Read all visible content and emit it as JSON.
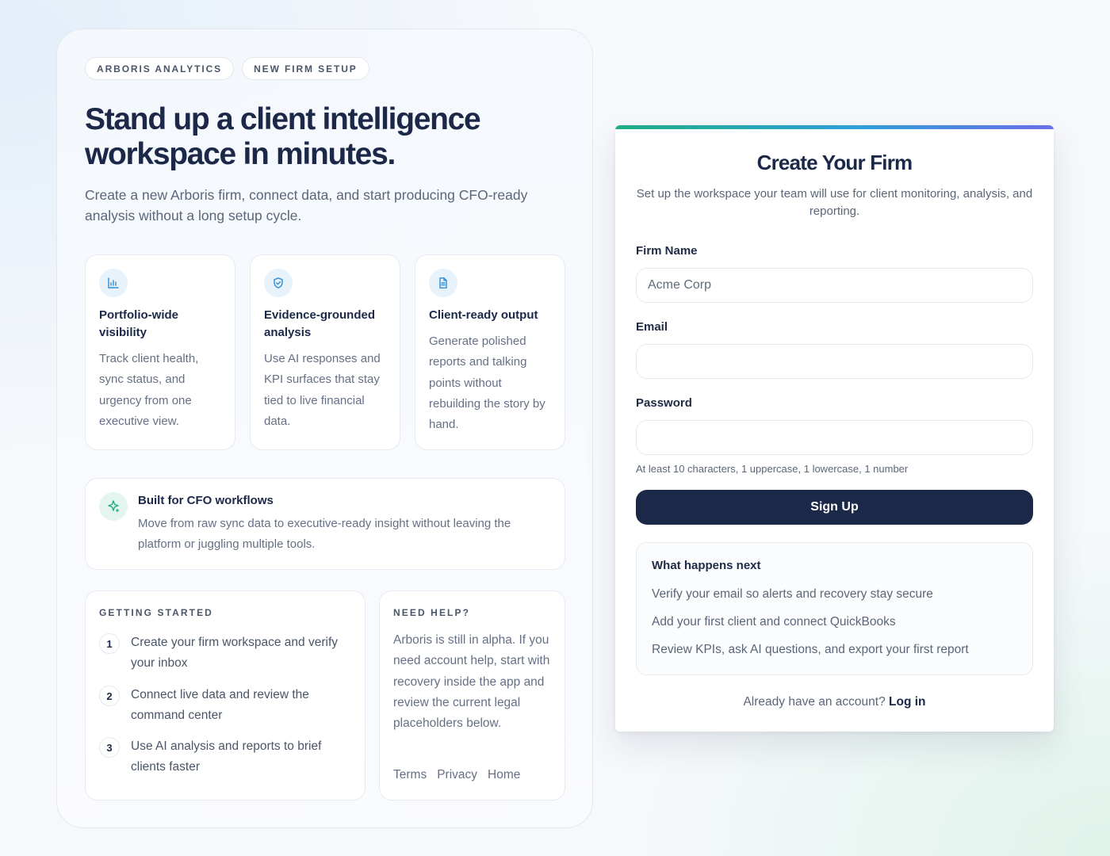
{
  "left": {
    "chips": [
      "ARBORIS ANALYTICS",
      "NEW FIRM SETUP"
    ],
    "title": "Stand up a client intelligence workspace in minutes.",
    "subtitle": "Create a new Arboris firm, connect data, and start producing CFO-ready analysis without a long setup cycle.",
    "features": [
      {
        "icon": "bar-chart-icon",
        "title": "Portfolio-wide visibility",
        "body": "Track client health, sync status, and urgency from one executive view."
      },
      {
        "icon": "shield-check-icon",
        "title": "Evidence-grounded analysis",
        "body": "Use AI responses and KPI surfaces that stay tied to live financial data."
      },
      {
        "icon": "document-icon",
        "title": "Client-ready output",
        "body": "Generate polished reports and talking points without rebuilding the story by hand."
      }
    ],
    "cfo": {
      "icon": "sparkle-icon",
      "title": "Built for CFO workflows",
      "body": "Move from raw sync data to executive-ready insight without leaving the platform or juggling multiple tools."
    },
    "getting_started": {
      "heading": "GETTING STARTED",
      "steps": [
        {
          "num": "1",
          "text": "Create your firm workspace and verify your inbox"
        },
        {
          "num": "2",
          "text": "Connect live data and review the command center"
        },
        {
          "num": "3",
          "text": "Use AI analysis and reports to brief clients faster"
        }
      ]
    },
    "help": {
      "heading": "NEED HELP?",
      "body": "Arboris is still in alpha. If you need account help, start with recovery inside the app and review the current legal placeholders below.",
      "links": [
        "Terms",
        "Privacy",
        "Home"
      ]
    }
  },
  "form": {
    "title": "Create Your Firm",
    "subtitle": "Set up the workspace your team will use for client monitoring, analysis, and reporting.",
    "firm_name_label": "Firm Name",
    "firm_name_placeholder": "Acme Corp",
    "email_label": "Email",
    "email_value": "",
    "password_label": "Password",
    "password_value": "",
    "password_hint": "At least 10 characters, 1 uppercase, 1 lowercase, 1 number",
    "submit_label": "Sign Up",
    "next": {
      "title": "What happens next",
      "items": [
        "Verify your email so alerts and recovery stay secure",
        "Add your first client and connect QuickBooks",
        "Review KPIs, ask AI questions, and export your first report"
      ]
    },
    "login_prompt": "Already have an account?",
    "login_link": "Log in"
  },
  "colors": {
    "accent": "#1c2848",
    "gradient": [
      "#1fae86",
      "#2f9fd8",
      "#6b6ee8"
    ],
    "icon_bg_blue": "#e7f2fb",
    "icon_bg_green": "#e4f5ed"
  }
}
